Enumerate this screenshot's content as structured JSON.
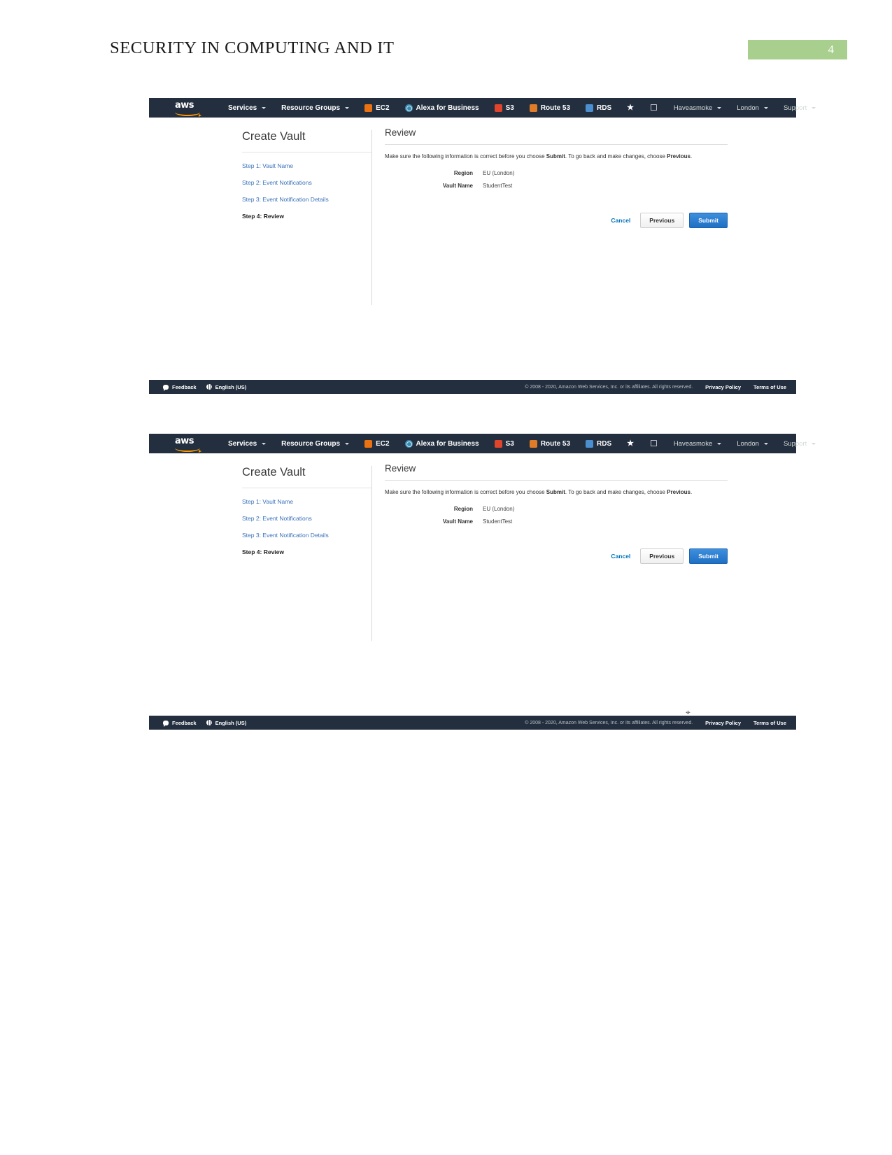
{
  "document": {
    "header_title": "SECURITY IN COMPUTING AND IT",
    "page_number": "4",
    "badge_color": "#a8cf8e"
  },
  "aws_console": {
    "navbar": {
      "logo_text": "aws",
      "items": [
        {
          "label": "Services",
          "icon": "none",
          "caret": true
        },
        {
          "label": "Resource Groups",
          "icon": "none",
          "caret": true
        },
        {
          "label": "EC2",
          "icon": "ec2-icon",
          "caret": false
        },
        {
          "label": "Alexa for Business",
          "icon": "alexa-icon",
          "caret": false
        },
        {
          "label": "S3",
          "icon": "s3-icon",
          "caret": false
        },
        {
          "label": "Route 53",
          "icon": "route53-icon",
          "caret": false
        },
        {
          "label": "RDS",
          "icon": "rds-icon",
          "caret": false
        }
      ],
      "pin_icon": "★",
      "bell_icon": "🔔",
      "account": "Haveasmoke",
      "region": "London",
      "support": "Support"
    },
    "sidebar": {
      "title": "Create Vault",
      "steps": [
        {
          "label": "Step 1: Vault Name",
          "current": false
        },
        {
          "label": "Step 2: Event Notifications",
          "current": false
        },
        {
          "label": "Step 3: Event Notification Details",
          "current": false
        },
        {
          "label": "Step 4: Review",
          "current": true
        }
      ]
    },
    "panel": {
      "title": "Review",
      "lede_part1": "Make sure the following information is correct before you choose ",
      "lede_submit": "Submit",
      "lede_part2": ". To go back and make changes, choose ",
      "lede_previous": "Previous",
      "lede_part3": ".",
      "fields": [
        {
          "key": "Region",
          "value": "EU (London)"
        },
        {
          "key": "Vault Name",
          "value": "StudentTest"
        }
      ],
      "cancel_label": "Cancel",
      "previous_label": "Previous",
      "submit_label": "Submit"
    },
    "footer": {
      "feedback": "Feedback",
      "language": "English (US)",
      "copyright": "© 2008 - 2020, Amazon Web Services, Inc. or its affiliates. All rights reserved.",
      "privacy": "Privacy Policy",
      "terms": "Terms of Use"
    }
  },
  "cursor": {
    "glyph": "⌖"
  }
}
